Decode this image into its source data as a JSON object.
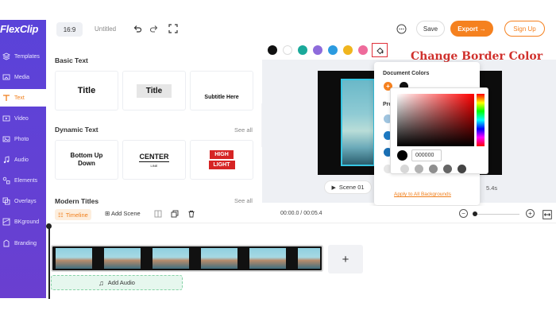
{
  "app": {
    "logo": "FlexClip"
  },
  "sidebar": {
    "items": [
      {
        "label": "Templates",
        "icon": "templates-icon"
      },
      {
        "label": "Media",
        "icon": "media-icon"
      },
      {
        "label": "Text",
        "icon": "text-icon",
        "active": true
      },
      {
        "label": "Video",
        "icon": "video-icon"
      },
      {
        "label": "Photo",
        "icon": "photo-icon"
      },
      {
        "label": "Audio",
        "icon": "audio-icon"
      },
      {
        "label": "Elements",
        "icon": "elements-icon"
      },
      {
        "label": "Overlays",
        "icon": "overlays-icon"
      },
      {
        "label": "BKground",
        "icon": "background-icon"
      },
      {
        "label": "Branding",
        "icon": "branding-icon"
      }
    ]
  },
  "toolbar": {
    "ratio": "16:9",
    "doc_title": "Untitled",
    "save_label": "Save",
    "export_label": "Export →",
    "signup_label": "Sign Up"
  },
  "panel": {
    "basic_title": "Basic Text",
    "basic_cards": [
      "Title",
      "Title",
      "Subtitle Here"
    ],
    "dynamic_title": "Dynamic Text",
    "dynamic_see_all": "See all",
    "dynamic_cards": {
      "bounce": "Bottom Up Down",
      "center_main": "CENTER",
      "center_sub": "LINE",
      "high": "HIGH",
      "light": "LIGHT"
    },
    "modern_title": "Modern Titles",
    "modern_see_all": "See all"
  },
  "colors": {
    "accent": "#f5811f",
    "sidebar": "#5b3fd6",
    "palette": [
      "#111111",
      "#ffffff",
      "#1aa99a",
      "#8e6bdb",
      "#2b9be0",
      "#f0b51e",
      "#ee6b9b"
    ]
  },
  "annotation": {
    "text": "Change Border Color"
  },
  "popover": {
    "document_colors_label": "Document Colors",
    "presets_label": "Pre",
    "hex_value": "000000",
    "apply_label": "Apply to All Backgrounds"
  },
  "preview": {
    "scene_label": "Scene 01",
    "duration": "5.4s"
  },
  "timeline": {
    "tab_label": "Timeline",
    "add_scene_label": "Add Scene",
    "time_readout": "00:00.0 / 00:05.4",
    "add_audio_label": "Add Audio",
    "add_clip_label": "+"
  }
}
